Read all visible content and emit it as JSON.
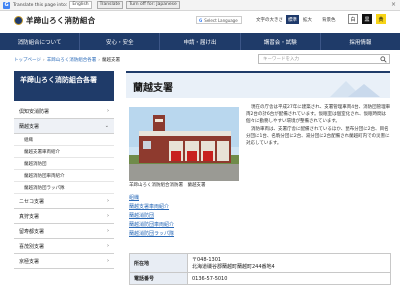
{
  "translate_bar": {
    "prefix": "Translate this page into:",
    "language": "English",
    "translate_button": "Translate",
    "turn_off": "Turn off for: Japanese"
  },
  "header": {
    "site_title": "羊蹄山ろく消防組合",
    "google_search": "Select Language",
    "font_size_label": "文字の大きさ",
    "font_standard": "標準",
    "font_large": "拡大",
    "bg_label": "背景色",
    "bg_white": "白",
    "bg_black": "黒",
    "bg_yellow": "黄"
  },
  "nav": [
    {
      "label": "消防組合について"
    },
    {
      "label": "安心・安全"
    },
    {
      "label": "申請・届け出"
    },
    {
      "label": "講習会・試験"
    },
    {
      "label": "採用情報"
    }
  ],
  "breadcrumb": {
    "home": "トップページ",
    "parent": "羊蹄山ろく消防組合各署",
    "current": "蘭越支署"
  },
  "keyword_search": {
    "placeholder": "キーワードを入力"
  },
  "sidebar": {
    "heading": "羊蹄山ろく消防組合各署",
    "items": [
      {
        "label": "倶知安消防署"
      },
      {
        "label": "蘭越支署"
      },
      {
        "label": "ニセコ支署"
      },
      {
        "label": "真狩支署"
      },
      {
        "label": "留寿都支署"
      },
      {
        "label": "喜茂別支署"
      },
      {
        "label": "京極支署"
      }
    ],
    "subitems": [
      {
        "label": "組織"
      },
      {
        "label": "蘭越支署車両紹介"
      },
      {
        "label": "蘭越消防団"
      },
      {
        "label": "蘭越消防団車両紹介"
      },
      {
        "label": "蘭越消防団ラッパ隊"
      }
    ]
  },
  "content": {
    "title": "蘭越支署",
    "photo_caption": "羊蹄山ろく消防組合消防署　蘭越支署",
    "paragraphs": [
      "現在の庁舎は平成27年に建築され、支署管理車両4台、消防団管理車両2台の計6台が配備されています。仮眠室は個室化され、仮眠時間は個々に勤務しやすい環境が整備されています。",
      "消防車両は、支署庁舎に配備されているほか、昆布分団に2台、目名分団に1台、名駒分団に2台、湯分団に2台配備され蘭越町内での災害に対応しています。"
    ],
    "links": [
      {
        "label": "組織"
      },
      {
        "label": "蘭越支署車両紹介"
      },
      {
        "label": "蘭越消防団"
      },
      {
        "label": "蘭越消防団車両紹介"
      },
      {
        "label": "蘭越消防団ラッパ隊"
      }
    ],
    "info": {
      "address_label": "所在地",
      "postal": "〒048-1301",
      "address": "北海道磯谷郡蘭越町蘭越町244番地4",
      "phone_label": "電話番号",
      "phone": "0136-57-5010"
    }
  }
}
